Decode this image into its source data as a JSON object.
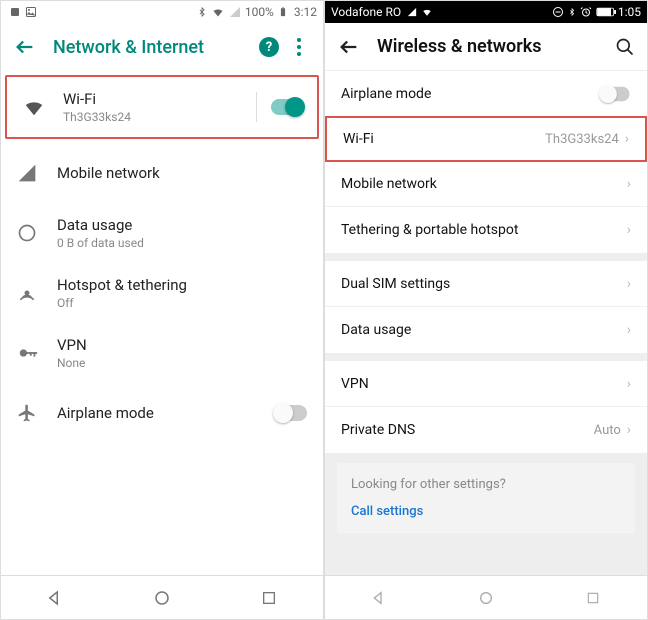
{
  "left": {
    "status": {
      "battery": "100%",
      "time": "3:12"
    },
    "header": {
      "title": "Network & Internet"
    },
    "rows": {
      "wifi": {
        "title": "Wi-Fi",
        "sub": "Th3G33ks24"
      },
      "mobile": {
        "title": "Mobile network"
      },
      "data": {
        "title": "Data usage",
        "sub": "0 B of data used"
      },
      "hotspot": {
        "title": "Hotspot & tethering",
        "sub": "Off"
      },
      "vpn": {
        "title": "VPN",
        "sub": "None"
      },
      "air": {
        "title": "Airplane mode"
      }
    }
  },
  "right": {
    "status": {
      "carrier": "Vodafone RO",
      "time": "1:05"
    },
    "header": {
      "title": "Wireless & networks"
    },
    "rows": {
      "air": {
        "title": "Airplane mode"
      },
      "wifi": {
        "title": "Wi-Fi",
        "val": "Th3G33ks24"
      },
      "mobile": {
        "title": "Mobile network"
      },
      "tether": {
        "title": "Tethering & portable hotspot"
      },
      "sim": {
        "title": "Dual SIM settings"
      },
      "data": {
        "title": "Data usage"
      },
      "vpn": {
        "title": "VPN"
      },
      "dns": {
        "title": "Private DNS",
        "val": "Auto"
      }
    },
    "footer": {
      "question": "Looking for other settings?",
      "link": "Call settings"
    }
  }
}
